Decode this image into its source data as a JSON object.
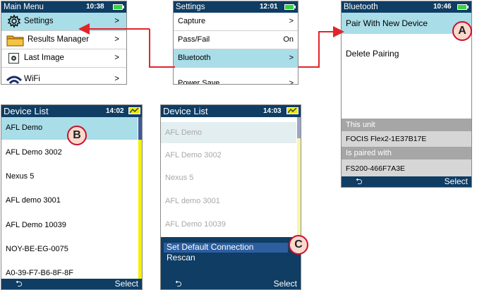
{
  "main_menu": {
    "title": "Main Menu",
    "time": "10:38",
    "items": [
      {
        "label": "Settings",
        "value": ">",
        "icon": "gear-icon"
      },
      {
        "label": "Results Manager",
        "value": ">",
        "icon": "folder-icon"
      },
      {
        "label": "Last Image",
        "value": ">",
        "icon": "image-icon"
      },
      {
        "label": "WiFi",
        "value": ">",
        "icon": "wifi-icon"
      }
    ]
  },
  "settings": {
    "title": "Settings",
    "time": "12:01",
    "items": [
      {
        "label": "Capture",
        "value": ">"
      },
      {
        "label": "Pass/Fail",
        "value": "On"
      },
      {
        "label": "Bluetooth",
        "value": ">"
      },
      {
        "label": "Power Save",
        "value": ">"
      }
    ]
  },
  "bluetooth": {
    "title": "Bluetooth",
    "time": "10:46",
    "items": [
      {
        "label": "Pair With New Device"
      },
      {
        "label": "Delete Pairing"
      }
    ],
    "this_unit_label": "This unit",
    "this_unit_value": "FOCIS Flex2-1E37B17E",
    "paired_label": "Is paired with",
    "paired_value": "FS200-466F7A3E",
    "back_glyph": "⮌",
    "select_label": "Select"
  },
  "device_list_1": {
    "title": "Device List",
    "time": "14:02",
    "devices": [
      "AFL Demo",
      "AFL Demo 3002",
      "Nexus 5",
      "AFL demo 3001",
      "AFL Demo 10039",
      "NOY-BE-EG-0075",
      "A0-39-F7-B6-8F-8F"
    ],
    "back_glyph": "⮌",
    "select_label": "Select"
  },
  "device_list_2": {
    "title": "Device List",
    "time": "14:03",
    "devices": [
      "AFL Demo",
      "AFL Demo 3002",
      "Nexus 5",
      "AFL demo 3001",
      "AFL Demo 10039"
    ],
    "popup": [
      "Set Default Connection",
      "Rescan"
    ],
    "back_glyph": "⮌",
    "select_label": "Select"
  },
  "callouts": {
    "a": "A",
    "b": "B",
    "c": "C"
  },
  "colors": {
    "title_bar": "#0f3d63",
    "highlight": "#a9dde8",
    "arrow": "#e0252b",
    "battery_green": "#39d43a",
    "battery_yellow": "#f2e600"
  }
}
